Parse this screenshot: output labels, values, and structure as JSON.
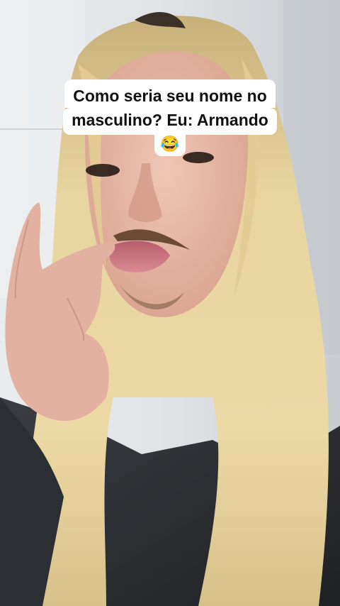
{
  "caption": {
    "line1": "Como seria seu nome no",
    "line2": "masculino? Eu: Armando",
    "emoji": "😂"
  },
  "colors": {
    "caption_background": "#ffffff",
    "caption_text": "#111111",
    "hair": "#e6d09a",
    "skin": "#e8b9a6",
    "lips": "#c9707c",
    "jacket": "#2a2c30",
    "background_wall": "#dfe3e6"
  }
}
